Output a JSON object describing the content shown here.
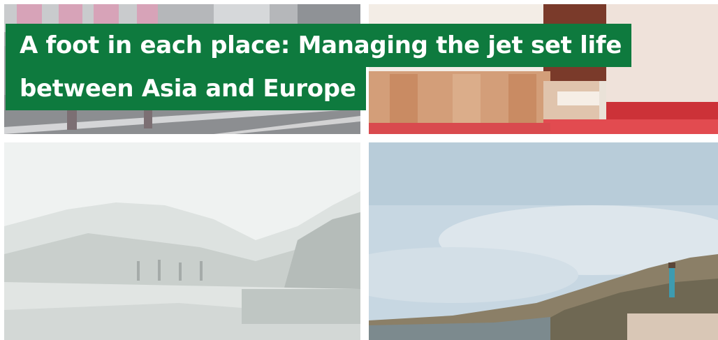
{
  "headline": {
    "line1": "A foot in each place: Managing the jet set life",
    "line2": "between Asia and Europe"
  },
  "colors": {
    "headline_background": "#0e7a3e",
    "headline_text": "#ffffff"
  },
  "photos": [
    {
      "name": "street-crowd-photo"
    },
    {
      "name": "wooden-interior-photo"
    },
    {
      "name": "snowy-mountains-photo"
    },
    {
      "name": "hillside-lake-photo"
    }
  ]
}
